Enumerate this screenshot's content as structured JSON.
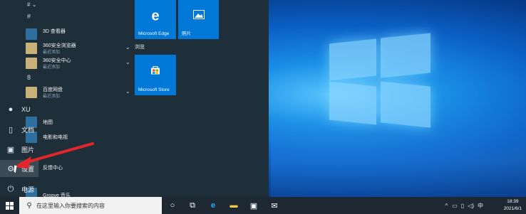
{
  "desktop": {},
  "start_menu": {
    "groups": [
      {
        "letter": "#"
      },
      {
        "letter": "8"
      }
    ],
    "apps": [
      {
        "name": "3D 查看器",
        "sub": ""
      },
      {
        "name": "360安全浏览器",
        "sub": "最近添加"
      },
      {
        "name": "360安全中心",
        "sub": "最近添加"
      },
      {
        "name": "百度网盘",
        "sub": "最近添加"
      },
      {
        "name": "地图",
        "sub": ""
      },
      {
        "name": "电影和电视",
        "sub": ""
      },
      {
        "name": "反馈中心",
        "sub": ""
      },
      {
        "name": "Groove 音乐",
        "sub": ""
      }
    ],
    "rail": {
      "user": "XU",
      "documents": "文档",
      "pictures": "图片",
      "settings": "设置",
      "power": "电源"
    },
    "tiles": {
      "edge": "Microsoft Edge",
      "photos": "照片",
      "section": "浏览",
      "store": "Microsoft Store"
    }
  },
  "taskbar": {
    "search_placeholder": "在这里输入你要搜索的内容",
    "tray_ime": "中",
    "time": "18:39",
    "date": "2021/6/1"
  },
  "colors": {
    "tile_blue": "#0078d7",
    "menu_bg": "#1f2f3a",
    "arrow_red": "#e3262b"
  }
}
